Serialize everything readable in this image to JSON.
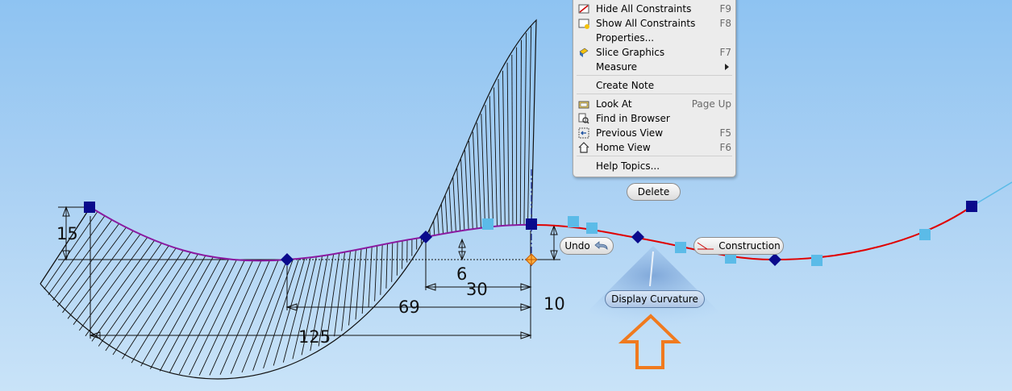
{
  "context_menu": {
    "items": [
      {
        "label": "Hide All Constraints",
        "shortcut": "F9",
        "icon": "hide-constraints-icon"
      },
      {
        "label": "Show All Constraints",
        "shortcut": "F8",
        "icon": "show-constraints-icon"
      },
      {
        "label": "Properties...",
        "shortcut": "",
        "icon": ""
      },
      {
        "label": "Slice Graphics",
        "shortcut": "F7",
        "icon": "slice-graphics-icon"
      },
      {
        "label": "Measure",
        "shortcut": "",
        "icon": "",
        "submenu": true
      },
      {
        "label": "Create Note",
        "shortcut": "",
        "icon": ""
      },
      {
        "label": "Look At",
        "shortcut": "Page Up",
        "icon": "look-at-icon"
      },
      {
        "label": "Find in Browser",
        "shortcut": "",
        "icon": "find-in-browser-icon"
      },
      {
        "label": "Previous View",
        "shortcut": "F5",
        "icon": "previous-view-icon"
      },
      {
        "label": "Home View",
        "shortcut": "F6",
        "icon": "home-view-icon"
      },
      {
        "label": "Help Topics...",
        "shortcut": "",
        "icon": ""
      }
    ]
  },
  "marking_menu": {
    "delete_label": "Delete",
    "undo_label": "Undo",
    "construction_label": "Construction",
    "display_curvature_label": "Display Curvature"
  },
  "dimensions": {
    "d15": "15",
    "d6": "6",
    "d30": "30",
    "d69": "69",
    "d10": "10",
    "d125": "125"
  },
  "colors": {
    "spline": "#e00000",
    "selected_curve": "#8a1aa0",
    "point": "#0a0a8c",
    "handle": "#5bbbe8",
    "comb": "#111111",
    "arrow_outline": "#f07a1e"
  }
}
